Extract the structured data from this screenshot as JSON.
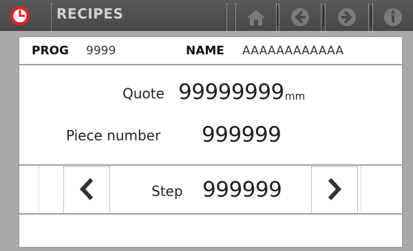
{
  "header": {
    "title": "RECIPES",
    "icons": [
      "clock-icon",
      "home-icon",
      "back-icon",
      "forward-icon",
      "info-icon"
    ]
  },
  "recipe": {
    "prog_label": "PROG",
    "prog_value": "9999",
    "name_label": "NAME",
    "name_value": "AAAAAAAAAAAA"
  },
  "quote": {
    "label": "Quote",
    "value": "99999999",
    "unit": "mm"
  },
  "piece": {
    "label": "Piece number",
    "value": "999999"
  },
  "step": {
    "label": "Step",
    "value": "999999"
  },
  "colors": {
    "accent": "#e0222a",
    "header_bg": "#4d4d4d",
    "header_icon": "#7a7a7a",
    "background": "#a9a9a9"
  }
}
